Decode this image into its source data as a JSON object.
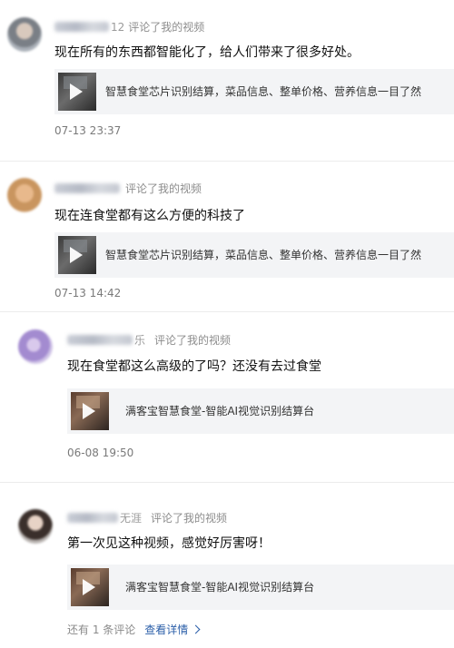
{
  "comments": [
    {
      "username_suffix": "12",
      "action": "评论了我的视频",
      "text": "现在所有的东西都智能化了，给人们带来了很多好处。",
      "video_title": "智慧食堂芯片识别结算，菜品信息、整单价格、营养信息一目了然",
      "time": "07-13 23:37",
      "avatar_icon": "user-avatar-icon"
    },
    {
      "username_suffix": "",
      "action": "评论了我的视频",
      "text": "现在连食堂都有这么方便的科技了",
      "video_title": "智慧食堂芯片识别结算，菜品信息、整单价格、营养信息一目了然",
      "time": "07-13 14:42",
      "avatar_icon": "user-avatar-icon"
    },
    {
      "username_suffix": "乐",
      "action": "评论了我的视频",
      "text": "现在食堂都这么高级的了吗？还没有去过食堂",
      "video_title": "满客宝智慧食堂-智能AI视觉识别结算台",
      "time": "06-08 19:50",
      "avatar_icon": "user-avatar-icon"
    },
    {
      "username_suffix": "无涯",
      "action": "评论了我的视频",
      "text": "第一次见这种视频，感觉好厉害呀！",
      "video_title": "满客宝智慧食堂-智能AI视觉识别结算台",
      "time": "",
      "avatar_icon": "user-avatar-icon"
    }
  ],
  "footer": {
    "more_replies": "还有 1 条评论",
    "view_details": "查看详情"
  },
  "colors": {
    "link": "#2a5ea8",
    "card_bg": "#f3f4f6",
    "muted": "#8c8c8c"
  }
}
